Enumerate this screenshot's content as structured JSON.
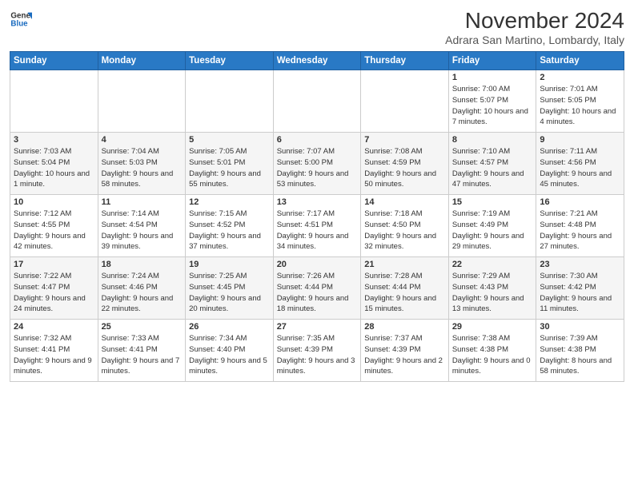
{
  "logo": {
    "line1": "General",
    "line2": "Blue"
  },
  "title": "November 2024",
  "location": "Adrara San Martino, Lombardy, Italy",
  "days_of_week": [
    "Sunday",
    "Monday",
    "Tuesday",
    "Wednesday",
    "Thursday",
    "Friday",
    "Saturday"
  ],
  "weeks": [
    [
      {
        "day": "",
        "info": ""
      },
      {
        "day": "",
        "info": ""
      },
      {
        "day": "",
        "info": ""
      },
      {
        "day": "",
        "info": ""
      },
      {
        "day": "",
        "info": ""
      },
      {
        "day": "1",
        "info": "Sunrise: 7:00 AM\nSunset: 5:07 PM\nDaylight: 10 hours and 7 minutes."
      },
      {
        "day": "2",
        "info": "Sunrise: 7:01 AM\nSunset: 5:05 PM\nDaylight: 10 hours and 4 minutes."
      }
    ],
    [
      {
        "day": "3",
        "info": "Sunrise: 7:03 AM\nSunset: 5:04 PM\nDaylight: 10 hours and 1 minute."
      },
      {
        "day": "4",
        "info": "Sunrise: 7:04 AM\nSunset: 5:03 PM\nDaylight: 9 hours and 58 minutes."
      },
      {
        "day": "5",
        "info": "Sunrise: 7:05 AM\nSunset: 5:01 PM\nDaylight: 9 hours and 55 minutes."
      },
      {
        "day": "6",
        "info": "Sunrise: 7:07 AM\nSunset: 5:00 PM\nDaylight: 9 hours and 53 minutes."
      },
      {
        "day": "7",
        "info": "Sunrise: 7:08 AM\nSunset: 4:59 PM\nDaylight: 9 hours and 50 minutes."
      },
      {
        "day": "8",
        "info": "Sunrise: 7:10 AM\nSunset: 4:57 PM\nDaylight: 9 hours and 47 minutes."
      },
      {
        "day": "9",
        "info": "Sunrise: 7:11 AM\nSunset: 4:56 PM\nDaylight: 9 hours and 45 minutes."
      }
    ],
    [
      {
        "day": "10",
        "info": "Sunrise: 7:12 AM\nSunset: 4:55 PM\nDaylight: 9 hours and 42 minutes."
      },
      {
        "day": "11",
        "info": "Sunrise: 7:14 AM\nSunset: 4:54 PM\nDaylight: 9 hours and 39 minutes."
      },
      {
        "day": "12",
        "info": "Sunrise: 7:15 AM\nSunset: 4:52 PM\nDaylight: 9 hours and 37 minutes."
      },
      {
        "day": "13",
        "info": "Sunrise: 7:17 AM\nSunset: 4:51 PM\nDaylight: 9 hours and 34 minutes."
      },
      {
        "day": "14",
        "info": "Sunrise: 7:18 AM\nSunset: 4:50 PM\nDaylight: 9 hours and 32 minutes."
      },
      {
        "day": "15",
        "info": "Sunrise: 7:19 AM\nSunset: 4:49 PM\nDaylight: 9 hours and 29 minutes."
      },
      {
        "day": "16",
        "info": "Sunrise: 7:21 AM\nSunset: 4:48 PM\nDaylight: 9 hours and 27 minutes."
      }
    ],
    [
      {
        "day": "17",
        "info": "Sunrise: 7:22 AM\nSunset: 4:47 PM\nDaylight: 9 hours and 24 minutes."
      },
      {
        "day": "18",
        "info": "Sunrise: 7:24 AM\nSunset: 4:46 PM\nDaylight: 9 hours and 22 minutes."
      },
      {
        "day": "19",
        "info": "Sunrise: 7:25 AM\nSunset: 4:45 PM\nDaylight: 9 hours and 20 minutes."
      },
      {
        "day": "20",
        "info": "Sunrise: 7:26 AM\nSunset: 4:44 PM\nDaylight: 9 hours and 18 minutes."
      },
      {
        "day": "21",
        "info": "Sunrise: 7:28 AM\nSunset: 4:44 PM\nDaylight: 9 hours and 15 minutes."
      },
      {
        "day": "22",
        "info": "Sunrise: 7:29 AM\nSunset: 4:43 PM\nDaylight: 9 hours and 13 minutes."
      },
      {
        "day": "23",
        "info": "Sunrise: 7:30 AM\nSunset: 4:42 PM\nDaylight: 9 hours and 11 minutes."
      }
    ],
    [
      {
        "day": "24",
        "info": "Sunrise: 7:32 AM\nSunset: 4:41 PM\nDaylight: 9 hours and 9 minutes."
      },
      {
        "day": "25",
        "info": "Sunrise: 7:33 AM\nSunset: 4:41 PM\nDaylight: 9 hours and 7 minutes."
      },
      {
        "day": "26",
        "info": "Sunrise: 7:34 AM\nSunset: 4:40 PM\nDaylight: 9 hours and 5 minutes."
      },
      {
        "day": "27",
        "info": "Sunrise: 7:35 AM\nSunset: 4:39 PM\nDaylight: 9 hours and 3 minutes."
      },
      {
        "day": "28",
        "info": "Sunrise: 7:37 AM\nSunset: 4:39 PM\nDaylight: 9 hours and 2 minutes."
      },
      {
        "day": "29",
        "info": "Sunrise: 7:38 AM\nSunset: 4:38 PM\nDaylight: 9 hours and 0 minutes."
      },
      {
        "day": "30",
        "info": "Sunrise: 7:39 AM\nSunset: 4:38 PM\nDaylight: 8 hours and 58 minutes."
      }
    ]
  ]
}
